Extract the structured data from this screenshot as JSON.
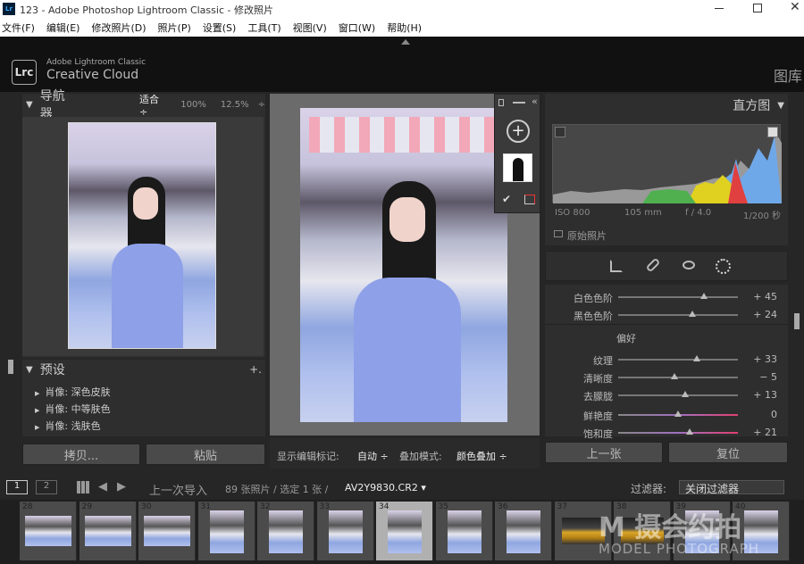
{
  "window": {
    "title": "123 - Adobe Photoshop Lightroom Classic - 修改照片"
  },
  "menu": [
    "文件(F)",
    "编辑(E)",
    "修改照片(D)",
    "照片(P)",
    "设置(S)",
    "工具(T)",
    "视图(V)",
    "窗口(W)",
    "帮助(H)"
  ],
  "identity": {
    "logo": "Lrc",
    "brand_line1": "Adobe Lightroom Classic",
    "brand_line2": "Creative Cloud",
    "module": "图库"
  },
  "navigator": {
    "title": "导航器",
    "zoom_fit": "适合 ÷",
    "zoom_100": "100%",
    "zoom_125": "12.5%",
    "zoom_arrow": "÷"
  },
  "presets": {
    "title": "预设",
    "add": "+.",
    "items": [
      {
        "arrow": "▶",
        "label": "肖像: 深色皮肤"
      },
      {
        "arrow": "▶",
        "label": "肖像: 中等肤色"
      },
      {
        "arrow": "▶",
        "label": "肖像: 浅肤色"
      }
    ]
  },
  "left_buttons": {
    "copy": "拷贝...",
    "paste": "粘贴"
  },
  "toolbar": {
    "show_edit_pins_label": "显示编辑标记:",
    "show_edit_pins_value": "自动 ÷",
    "overlay_label": "叠加模式:",
    "overlay_value": "颜色叠加 ÷"
  },
  "histogram": {
    "title": "直方图",
    "iso": "ISO 800",
    "focal": "105 mm",
    "aperture": "f / 4.0",
    "shutter": "1/200 秒",
    "original_label": "原始照片"
  },
  "sliders_top": [
    {
      "label": "白色色阶",
      "value": "+ 45",
      "pos": 0.72
    },
    {
      "label": "黑色色阶",
      "value": "+ 24",
      "pos": 0.62
    }
  ],
  "presence": {
    "title": "偏好"
  },
  "sliders_presence": [
    {
      "label": "纹理",
      "value": "+ 33",
      "pos": 0.66
    },
    {
      "label": "清晰度",
      "value": "− 5",
      "pos": 0.47
    },
    {
      "label": "去朦胧",
      "value": "+ 13",
      "pos": 0.56
    }
  ],
  "sliders_color": [
    {
      "label": "鲜艳度",
      "value": "0",
      "pos": 0.5
    },
    {
      "label": "饱和度",
      "value": "+ 21",
      "pos": 0.6
    }
  ],
  "right_buttons": {
    "previous": "上一张",
    "reset": "复位"
  },
  "filmstrip_bar": {
    "page1": "1",
    "page2": "2",
    "source": "上一次导入",
    "count": "89 张照片 / 选定 1 张 /",
    "filename": "AV2Y9830.CR2 ▾",
    "filter_label": "过滤器:",
    "filter_value": "关闭过滤器"
  },
  "filmstrip": [
    {
      "num": "28",
      "type": "group"
    },
    {
      "num": "29",
      "type": "group"
    },
    {
      "num": "30",
      "type": "group"
    },
    {
      "num": "31",
      "type": "portrait"
    },
    {
      "num": "32",
      "type": "portrait"
    },
    {
      "num": "33",
      "type": "portrait"
    },
    {
      "num": "34",
      "type": "portrait"
    },
    {
      "num": "35",
      "type": "portrait"
    },
    {
      "num": "36",
      "type": "portrait"
    },
    {
      "num": "37",
      "type": "landscape"
    },
    {
      "num": "38",
      "type": "landscape"
    },
    {
      "num": "39",
      "type": "portrait"
    },
    {
      "num": "40",
      "type": "portrait"
    }
  ],
  "watermark": {
    "line1": "M 摄会约拍",
    "line2": "MODEL PHOTOGRAPH"
  }
}
